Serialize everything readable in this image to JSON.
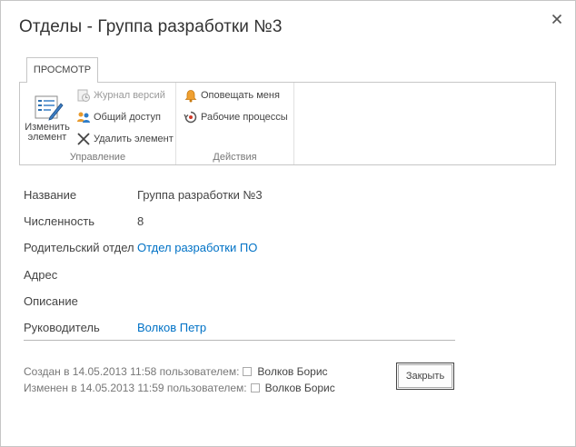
{
  "dialog": {
    "title": "Отделы - Группа разработки №3",
    "close_icon": "close-icon"
  },
  "ribbon": {
    "tab_label": "ПРОСМОТР",
    "groups": {
      "manage": {
        "label": "Управление",
        "edit_label_line1": "Изменить",
        "edit_label_line2": "элемент",
        "version_history": "Журнал версий",
        "shared_with": "Общий доступ",
        "delete_item": "Удалить элемент"
      },
      "actions": {
        "label": "Действия",
        "alert_me": "Оповещать меня",
        "workflows": "Рабочие процессы"
      }
    }
  },
  "properties": {
    "name_label": "Название",
    "name_value": "Группа разработки №3",
    "size_label": "Численность",
    "size_value": "8",
    "parent_label": "Родительский отдел",
    "parent_value": "Отдел разработки ПО",
    "address_label": "Адрес",
    "address_value": "",
    "description_label": "Описание",
    "description_value": "",
    "manager_label": "Руководитель",
    "manager_value": "Волков Петр"
  },
  "footer": {
    "created_prefix": "Создан в 14.05.2013 11:58 пользователем:",
    "created_user": "Волков Борис",
    "modified_prefix": "Изменен в 14.05.2013 11:59 пользователем:",
    "modified_user": "Волков Борис",
    "close_button": "Закрыть"
  },
  "colors": {
    "link": "#0072c6",
    "border": "#c6c6c6",
    "text": "#444444"
  }
}
